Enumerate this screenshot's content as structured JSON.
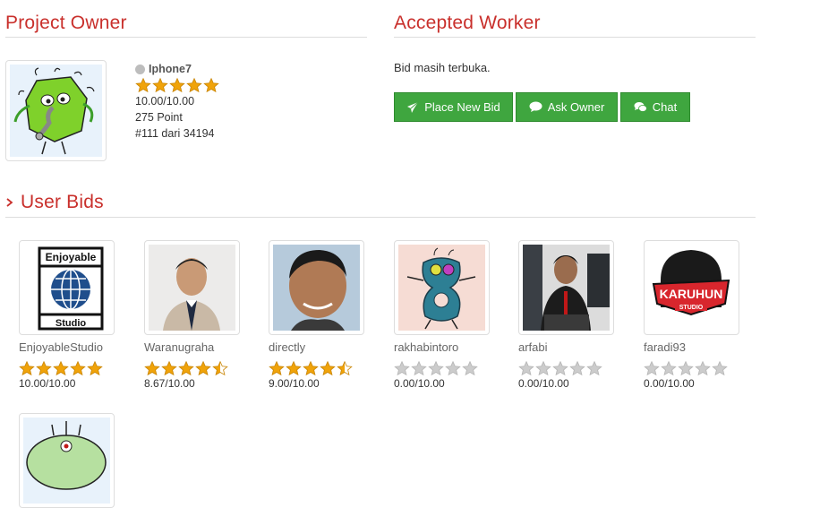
{
  "owner_section": {
    "title": "Project Owner",
    "name": "Iphone7",
    "rating": "10.00/10.00",
    "stars": 5,
    "points": "275 Point",
    "rank": "#111 dari 34194"
  },
  "worker_section": {
    "title": "Accepted Worker",
    "status": "Bid masih terbuka.",
    "buttons": {
      "place_bid": "Place New Bid",
      "ask_owner": "Ask Owner",
      "chat": "Chat"
    },
    "button_color": "#3fa63f"
  },
  "bids_section": {
    "title": "User Bids",
    "bidders": [
      {
        "name": "EnjoyableStudio",
        "score": "10.00/10.00",
        "stars": 5
      },
      {
        "name": "Waranugraha",
        "score": "8.67/10.00",
        "stars": 4.5
      },
      {
        "name": "directly",
        "score": "9.00/10.00",
        "stars": 4.5
      },
      {
        "name": "rakhabintoro",
        "score": "0.00/10.00",
        "stars": 0
      },
      {
        "name": "arfabi",
        "score": "0.00/10.00",
        "stars": 0
      },
      {
        "name": "faradi93",
        "score": "0.00/10.00",
        "stars": 0
      }
    ],
    "avatar_logo_text": {
      "enjoyable_top": "Enjoyable",
      "enjoyable_bottom": "Studio",
      "karuhun_top": "KARUHUN",
      "karuhun_bottom": "STUDIO"
    }
  },
  "colors": {
    "accent": "#c9302c",
    "star_on": "#f0a30a",
    "star_off": "#cccccc",
    "rule": "#dddddd"
  }
}
